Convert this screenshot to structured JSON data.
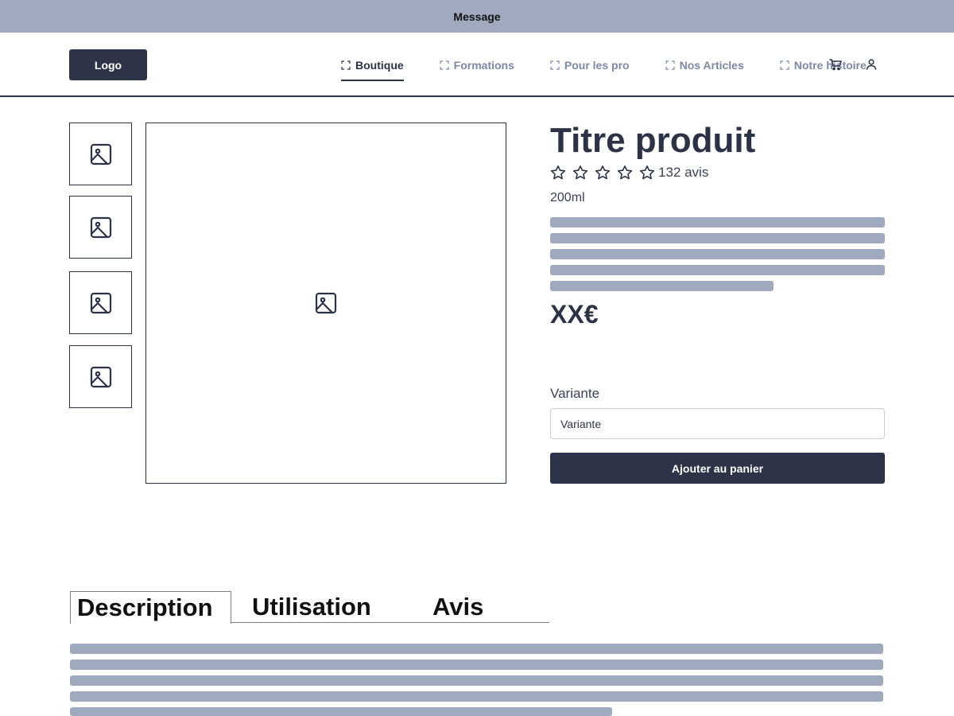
{
  "message_bar": {
    "text": "Message"
  },
  "header": {
    "logo_label": "Logo",
    "nav": [
      {
        "label": "Boutique",
        "active": true
      },
      {
        "label": "Formations",
        "active": false
      },
      {
        "label": "Pour les pro",
        "active": false
      },
      {
        "label": "Nos Articles",
        "active": false
      },
      {
        "label": "Notre histoire",
        "active": false
      }
    ],
    "icons": [
      "cart-icon",
      "user-icon"
    ]
  },
  "product": {
    "title": "Titre produit",
    "rating": {
      "stars_filled": 0,
      "stars_total": 5,
      "reviews_label": "132 avis"
    },
    "volume": "200ml",
    "price": "XX€",
    "variant_label": "Variante",
    "variant_value": "Variante",
    "add_to_cart_label": "Ajouter au panier"
  },
  "gallery": {
    "thumbnail_count": 4,
    "icon": "image-icon"
  },
  "tabs": [
    {
      "label": "Description",
      "active": true
    },
    {
      "label": "Utilisation",
      "active": false
    },
    {
      "label": "Avis",
      "active": false
    }
  ],
  "colors": {
    "primary": "#2d3447",
    "placeholder": "#a0aabe",
    "nav_inactive": "#7c88a6"
  }
}
